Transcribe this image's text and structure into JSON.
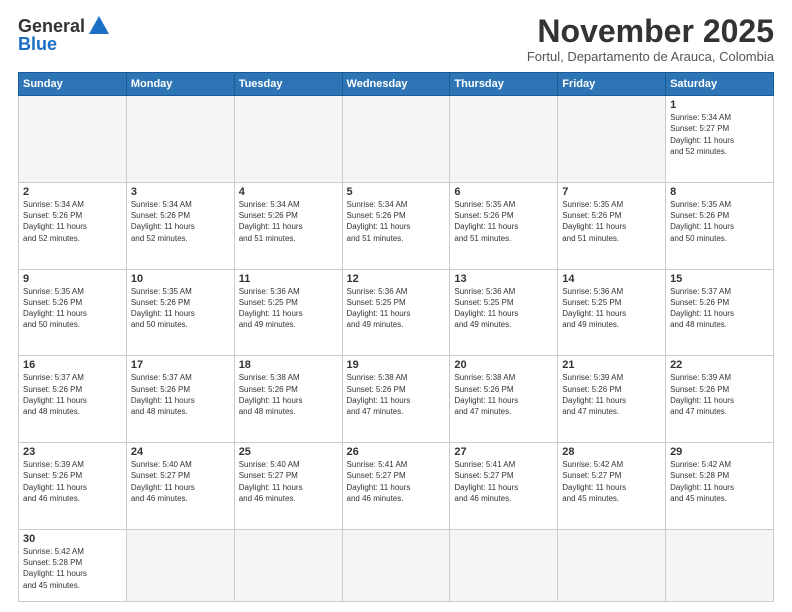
{
  "logo": {
    "general": "General",
    "blue": "Blue"
  },
  "header": {
    "month_title": "November 2025",
    "location": "Fortul, Departamento de Arauca, Colombia"
  },
  "days_of_week": [
    "Sunday",
    "Monday",
    "Tuesday",
    "Wednesday",
    "Thursday",
    "Friday",
    "Saturday"
  ],
  "weeks": [
    [
      {
        "day": "",
        "info": ""
      },
      {
        "day": "",
        "info": ""
      },
      {
        "day": "",
        "info": ""
      },
      {
        "day": "",
        "info": ""
      },
      {
        "day": "",
        "info": ""
      },
      {
        "day": "",
        "info": ""
      },
      {
        "day": "1",
        "info": "Sunrise: 5:34 AM\nSunset: 5:27 PM\nDaylight: 11 hours\nand 52 minutes."
      }
    ],
    [
      {
        "day": "2",
        "info": "Sunrise: 5:34 AM\nSunset: 5:26 PM\nDaylight: 11 hours\nand 52 minutes."
      },
      {
        "day": "3",
        "info": "Sunrise: 5:34 AM\nSunset: 5:26 PM\nDaylight: 11 hours\nand 52 minutes."
      },
      {
        "day": "4",
        "info": "Sunrise: 5:34 AM\nSunset: 5:26 PM\nDaylight: 11 hours\nand 51 minutes."
      },
      {
        "day": "5",
        "info": "Sunrise: 5:34 AM\nSunset: 5:26 PM\nDaylight: 11 hours\nand 51 minutes."
      },
      {
        "day": "6",
        "info": "Sunrise: 5:35 AM\nSunset: 5:26 PM\nDaylight: 11 hours\nand 51 minutes."
      },
      {
        "day": "7",
        "info": "Sunrise: 5:35 AM\nSunset: 5:26 PM\nDaylight: 11 hours\nand 51 minutes."
      },
      {
        "day": "8",
        "info": "Sunrise: 5:35 AM\nSunset: 5:26 PM\nDaylight: 11 hours\nand 50 minutes."
      }
    ],
    [
      {
        "day": "9",
        "info": "Sunrise: 5:35 AM\nSunset: 5:26 PM\nDaylight: 11 hours\nand 50 minutes."
      },
      {
        "day": "10",
        "info": "Sunrise: 5:35 AM\nSunset: 5:26 PM\nDaylight: 11 hours\nand 50 minutes."
      },
      {
        "day": "11",
        "info": "Sunrise: 5:36 AM\nSunset: 5:25 PM\nDaylight: 11 hours\nand 49 minutes."
      },
      {
        "day": "12",
        "info": "Sunrise: 5:36 AM\nSunset: 5:25 PM\nDaylight: 11 hours\nand 49 minutes."
      },
      {
        "day": "13",
        "info": "Sunrise: 5:36 AM\nSunset: 5:25 PM\nDaylight: 11 hours\nand 49 minutes."
      },
      {
        "day": "14",
        "info": "Sunrise: 5:36 AM\nSunset: 5:25 PM\nDaylight: 11 hours\nand 49 minutes."
      },
      {
        "day": "15",
        "info": "Sunrise: 5:37 AM\nSunset: 5:26 PM\nDaylight: 11 hours\nand 48 minutes."
      }
    ],
    [
      {
        "day": "16",
        "info": "Sunrise: 5:37 AM\nSunset: 5:26 PM\nDaylight: 11 hours\nand 48 minutes."
      },
      {
        "day": "17",
        "info": "Sunrise: 5:37 AM\nSunset: 5:26 PM\nDaylight: 11 hours\nand 48 minutes."
      },
      {
        "day": "18",
        "info": "Sunrise: 5:38 AM\nSunset: 5:26 PM\nDaylight: 11 hours\nand 48 minutes."
      },
      {
        "day": "19",
        "info": "Sunrise: 5:38 AM\nSunset: 5:26 PM\nDaylight: 11 hours\nand 47 minutes."
      },
      {
        "day": "20",
        "info": "Sunrise: 5:38 AM\nSunset: 5:26 PM\nDaylight: 11 hours\nand 47 minutes."
      },
      {
        "day": "21",
        "info": "Sunrise: 5:39 AM\nSunset: 5:26 PM\nDaylight: 11 hours\nand 47 minutes."
      },
      {
        "day": "22",
        "info": "Sunrise: 5:39 AM\nSunset: 5:26 PM\nDaylight: 11 hours\nand 47 minutes."
      }
    ],
    [
      {
        "day": "23",
        "info": "Sunrise: 5:39 AM\nSunset: 5:26 PM\nDaylight: 11 hours\nand 46 minutes."
      },
      {
        "day": "24",
        "info": "Sunrise: 5:40 AM\nSunset: 5:27 PM\nDaylight: 11 hours\nand 46 minutes."
      },
      {
        "day": "25",
        "info": "Sunrise: 5:40 AM\nSunset: 5:27 PM\nDaylight: 11 hours\nand 46 minutes."
      },
      {
        "day": "26",
        "info": "Sunrise: 5:41 AM\nSunset: 5:27 PM\nDaylight: 11 hours\nand 46 minutes."
      },
      {
        "day": "27",
        "info": "Sunrise: 5:41 AM\nSunset: 5:27 PM\nDaylight: 11 hours\nand 46 minutes."
      },
      {
        "day": "28",
        "info": "Sunrise: 5:42 AM\nSunset: 5:27 PM\nDaylight: 11 hours\nand 45 minutes."
      },
      {
        "day": "29",
        "info": "Sunrise: 5:42 AM\nSunset: 5:28 PM\nDaylight: 11 hours\nand 45 minutes."
      }
    ],
    [
      {
        "day": "30",
        "info": "Sunrise: 5:42 AM\nSunset: 5:28 PM\nDaylight: 11 hours\nand 45 minutes."
      },
      {
        "day": "",
        "info": ""
      },
      {
        "day": "",
        "info": ""
      },
      {
        "day": "",
        "info": ""
      },
      {
        "day": "",
        "info": ""
      },
      {
        "day": "",
        "info": ""
      },
      {
        "day": "",
        "info": ""
      }
    ]
  ]
}
